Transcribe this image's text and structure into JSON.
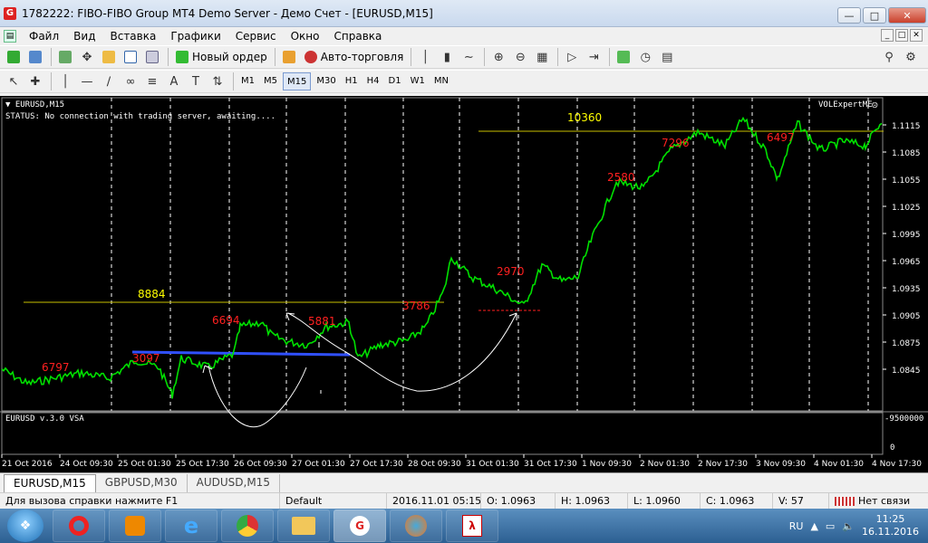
{
  "window": {
    "title": "1782222: FIBO-FIBO Group MT4 Demo Server - Демо Счет - [EURUSD,M15]",
    "app_icon": "G"
  },
  "menu": [
    "Файл",
    "Вид",
    "Вставка",
    "Графики",
    "Сервис",
    "Окно",
    "Справка"
  ],
  "toolbar1": {
    "new_order": "Новый ордер",
    "auto_trading": "Авто-торговля"
  },
  "timeframes": [
    "M1",
    "M5",
    "M15",
    "M30",
    "H1",
    "H4",
    "D1",
    "W1",
    "MN"
  ],
  "active_timeframe": "M15",
  "chart": {
    "symbol_label": "EURUSD,M15",
    "status": "STATUS:   No connection with trading server, awaiting....",
    "expert": "VOLExpertME",
    "indicator_label": "EURUSD v.3.0 VSA",
    "indicator_scale_top": "-9500000",
    "indicator_scale_bottom": "0",
    "price_ticks": [
      "1.1115",
      "1.1085",
      "1.1055",
      "1.1025",
      "1.0995",
      "1.0965",
      "1.0935",
      "1.0905",
      "1.0875",
      "1.0845"
    ],
    "time_ticks": [
      "21 Oct 2016",
      "24 Oct 09:30",
      "25 Oct 01:30",
      "25 Oct 17:30",
      "26 Oct 09:30",
      "27 Oct 01:30",
      "27 Oct 17:30",
      "28 Oct 09:30",
      "31 Oct 01:30",
      "31 Oct 17:30",
      "1 Nov 09:30",
      "2 Nov 01:30",
      "2 Nov 17:30",
      "3 Nov 09:30",
      "4 Nov 01:30",
      "4 Nov 17:30"
    ],
    "yellow_levels": [
      "8884",
      "10360"
    ],
    "red_labels": [
      "6797",
      "3097",
      "6694",
      "5881",
      "3786",
      "2970",
      "2580",
      "7296",
      "6497"
    ],
    "colors": {
      "price": "#00ff00",
      "yellow": "#ffff00",
      "red": "#ff2020",
      "blue": "#3050ff",
      "grid": "#ffffff"
    }
  },
  "chart_tabs": [
    "EURUSD,M15",
    "GBPUSD,M30",
    "AUDUSD,M15"
  ],
  "status_bar": {
    "help": "Для вызова справки нажмите F1",
    "profile": "Default",
    "time": "2016.11.01 05:15",
    "open": "O: 1.0963",
    "high": "H: 1.0963",
    "low": "L: 1.0960",
    "close": "C: 1.0963",
    "volume": "V: 57",
    "connection": "Нет связи"
  },
  "taskbar": {
    "lang": "RU",
    "time": "11:25",
    "date": "16.11.2016"
  }
}
